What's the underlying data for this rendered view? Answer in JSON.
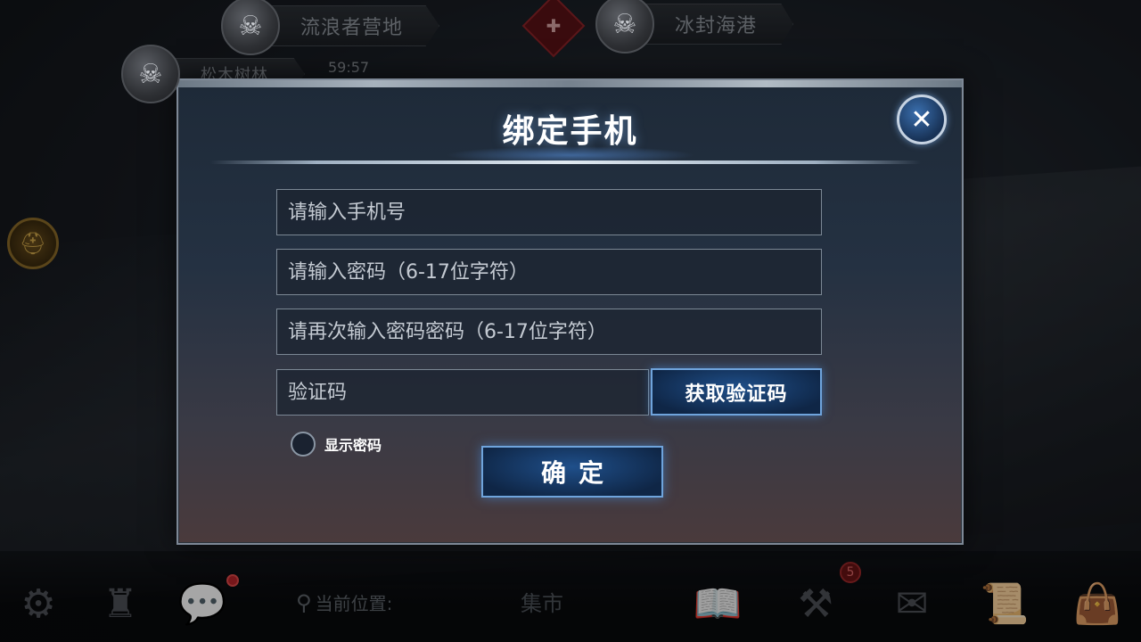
{
  "map": {
    "nodes": [
      {
        "label": "流浪者营地",
        "icon": "skull-horned-icon"
      },
      {
        "label": "冰封海港",
        "icon": "skull-crowned-icon"
      },
      {
        "label": "松木树林",
        "icon": "skull-horned-icon",
        "timer": "59:57"
      }
    ],
    "red_badge_icon": "tombstone-icon",
    "side_badge_icon": "helmet-icon"
  },
  "dialog": {
    "title": "绑定手机",
    "close_icon": "close-icon",
    "phone_placeholder": "请输入手机号",
    "password_placeholder": "请输入密码（6-17位字符）",
    "confirm_password_placeholder": "请再次输入密码密码（6-17位字符）",
    "code_placeholder": "验证码",
    "get_code_label": "获取验证码",
    "show_password_label": "显示密码",
    "confirm_label": "确定"
  },
  "bottom_bar": {
    "location_label": "当前位置:",
    "location_value": "集市",
    "notification_count": "5",
    "icons": [
      "gear-icon",
      "raven-icon",
      "chat-icon",
      "book-icon",
      "tools-icon",
      "mail-icon",
      "scroll-icon",
      "bag-icon"
    ]
  },
  "colors": {
    "accent_blue": "#6fa4dc",
    "button_fill": "#1f4f8a",
    "dialog_border": "#7d8896",
    "notification_red": "#b8262b"
  }
}
